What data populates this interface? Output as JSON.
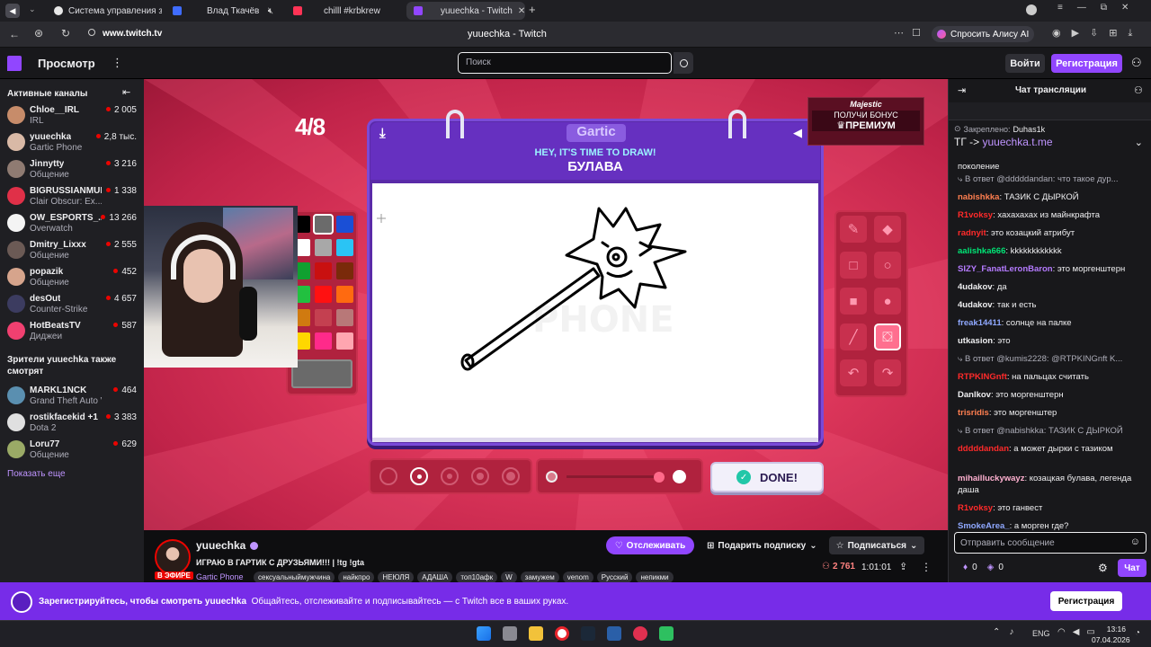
{
  "browser": {
    "tabs": [
      {
        "label": "Система управления зак",
        "color": "#e8e8e8"
      },
      {
        "label": "Влад Ткачёв",
        "color": "#3f6cff"
      },
      {
        "label": "chilll #krbkrew",
        "color": "#ff3355"
      },
      {
        "label": "yuuechka - Twitch",
        "color": "#9146ff"
      }
    ],
    "url": "www.twitch.tv",
    "page_title": "yuuechka - Twitch",
    "alice": "Спросить Алису AI"
  },
  "twitch": {
    "browse": "Просмотр",
    "search_placeholder": "Поиск",
    "login": "Войти",
    "register": "Регистрация"
  },
  "sidebar": {
    "header": "Активные каналы",
    "channels": [
      {
        "name": "Chloe__IRL",
        "game": "IRL",
        "viewers": "2 005",
        "color": "#c78c6a"
      },
      {
        "name": "yuuechka",
        "game": "Gartic Phone",
        "viewers": "2,8 тыс.",
        "color": "#d9b9a6"
      },
      {
        "name": "Jinnytty",
        "game": "Общение",
        "viewers": "3 216",
        "color": "#8f7b72"
      },
      {
        "name": "BIGRUSSIANMUM",
        "game": "Clair Obscur: Ex...",
        "viewers": "1 338",
        "color": "#e03048"
      },
      {
        "name": "OW_ESPORTS_...",
        "game": "Overwatch",
        "viewers": "13 266",
        "color": "#f4f4f4"
      },
      {
        "name": "Dmitry_Lixxx",
        "game": "Общение",
        "viewers": "2 555",
        "color": "#6b5a55"
      },
      {
        "name": "popazik",
        "game": "Общение",
        "viewers": "452",
        "color": "#d6a48c"
      },
      {
        "name": "desOut",
        "game": "Counter-Strike",
        "viewers": "4 657",
        "color": "#3c3c60"
      },
      {
        "name": "HotBeatsTV",
        "game": "Диджеи",
        "viewers": "587",
        "color": "#f04070"
      }
    ],
    "also_header": "Зрители yuuechka также смотрят",
    "also": [
      {
        "name": "MARKL1NCK",
        "game": "Grand Theft Auto V",
        "viewers": "464",
        "color": "#5a8fb0"
      },
      {
        "name": "rostikfacekid +1",
        "game": "Dota 2",
        "viewers": "3 383",
        "color": "#e0e0e0"
      },
      {
        "name": "Loru77",
        "game": "Общение",
        "viewers": "629",
        "color": "#9aaa66"
      }
    ],
    "show_more": "Показать еще"
  },
  "game": {
    "round": "4/8",
    "logo": "Gartic",
    "prompt": "HEY, IT'S TIME TO DRAW!",
    "word": "БУЛАВА",
    "done": "DONE!",
    "ad_brand": "Majestic",
    "ad_line1": "ПОЛУЧИ БОНУС",
    "ad_line2": "♛ПРЕМИУМ",
    "palette": [
      "#000000",
      "#6b6b6b",
      "#1a4fd6",
      "#ffffff",
      "#a8a8a8",
      "#2ac4f5",
      "#10a030",
      "#c91010",
      "#7a2a0a",
      "#22c040",
      "#ff1111",
      "#ff6a10",
      "#d07a10",
      "#c44050",
      "#b87878",
      "#ffd700",
      "#ff2a8a",
      "#ffa6b0"
    ]
  },
  "stream_info": {
    "channel": "yuuechka",
    "title": "ИГРАЮ В ГАРТИК С ДРУЗЬЯМИ!!! | !tg !gta",
    "live": "В ЭФИРЕ",
    "game": "Gartic Phone",
    "tags": [
      "сексуальныймужчина",
      "найкпро",
      "НЕЮЛЯ",
      "АДАША",
      "топ10афк",
      "W",
      "замужем",
      "venom",
      "Русский",
      "непикми"
    ],
    "follow": "Отслеживать",
    "gift": "Подарить подписку",
    "subscribe": "Подписаться",
    "viewers": "2 761",
    "uptime": "1:01:01"
  },
  "chat": {
    "title": "Чат трансляции",
    "pinned_by": "Закреплено:",
    "pinned_user": "Duhas1k",
    "pinned_text": "ТГ -> ",
    "pinned_link": "yuuechka.t.me",
    "cut": "поколение",
    "messages": [
      {
        "reply": "В ответ @dddddandan: что такое дур...",
        "user": "",
        "text": ""
      },
      {
        "reply": "",
        "user": "nabishkka",
        "color": "#ff7f50",
        "text": "ТАЗИК С ДЫРКОЙ"
      },
      {
        "reply": "",
        "user": "R1voksy",
        "color": "#ff2a2a",
        "text": "хахахахах из майнкрафта"
      },
      {
        "reply": "",
        "user": "radnyit",
        "color": "#ff2a2a",
        "text": "это козацкий атрибут"
      },
      {
        "reply": "",
        "user": "aalishka666",
        "color": "#00e676",
        "text": "kkkkkkkkkkkk"
      },
      {
        "reply": "",
        "user": "SIZY_FanatLeronBaron",
        "color": "#b57bff",
        "text": "это моргенштерн"
      },
      {
        "reply": "",
        "user": "4udakov",
        "color": "#efeff1",
        "text": "да"
      },
      {
        "reply": "",
        "user": "4udakov",
        "color": "#efeff1",
        "text": "так и есть"
      },
      {
        "reply": "",
        "user": "freak14411",
        "color": "#8fa8ff",
        "text": "солнце на палке"
      },
      {
        "reply": "",
        "user": "utkasion",
        "color": "#efeff1",
        "text": "это"
      },
      {
        "reply": "В ответ @kumis2228: @RTPKINGnft K...",
        "user": "",
        "text": ""
      },
      {
        "reply": "",
        "user": "RTPKINGnft",
        "color": "#ff2a2a",
        "text": "на пальцах считать"
      },
      {
        "reply": "",
        "user": "Danlkov",
        "color": "#efeff1",
        "text": "это моргенштерн"
      },
      {
        "reply": "",
        "user": "trisridis",
        "color": "#ff7f50",
        "text": "это моргенштер"
      },
      {
        "reply": "В ответ @nabishkka: ТАЗИК С ДЫРКОЙ",
        "user": "",
        "text": ""
      },
      {
        "reply": "",
        "user": "dddddandan",
        "color": "#ff2a2a",
        "text": "а может дырки с тазиком"
      },
      {
        "reply": "",
        "user": "mihailluckywayz",
        "color": "#ffb0d0",
        "text": "козацкая булава, легенда даша"
      },
      {
        "reply": "",
        "user": "R1voksy",
        "color": "#ff2a2a",
        "text": "это ганвест"
      },
      {
        "reply": "",
        "user": "SmokeArea_",
        "color": "#8fa8ff",
        "text": "а морген где?"
      }
    ],
    "input_placeholder": "Отправить сообщение",
    "points": "0",
    "bits": "0",
    "chat_button": "Чат"
  },
  "banner": {
    "text_bold": "Зарегистрируйтесь, чтобы смотреть yuuechka",
    "text": "Общайтесь, отслеживайте и подписывайтесь — с Twitch все в ваших руках.",
    "button": "Регистрация"
  },
  "taskbar": {
    "lang": "ENG",
    "time": "13:16",
    "date": "07.04.2026"
  }
}
